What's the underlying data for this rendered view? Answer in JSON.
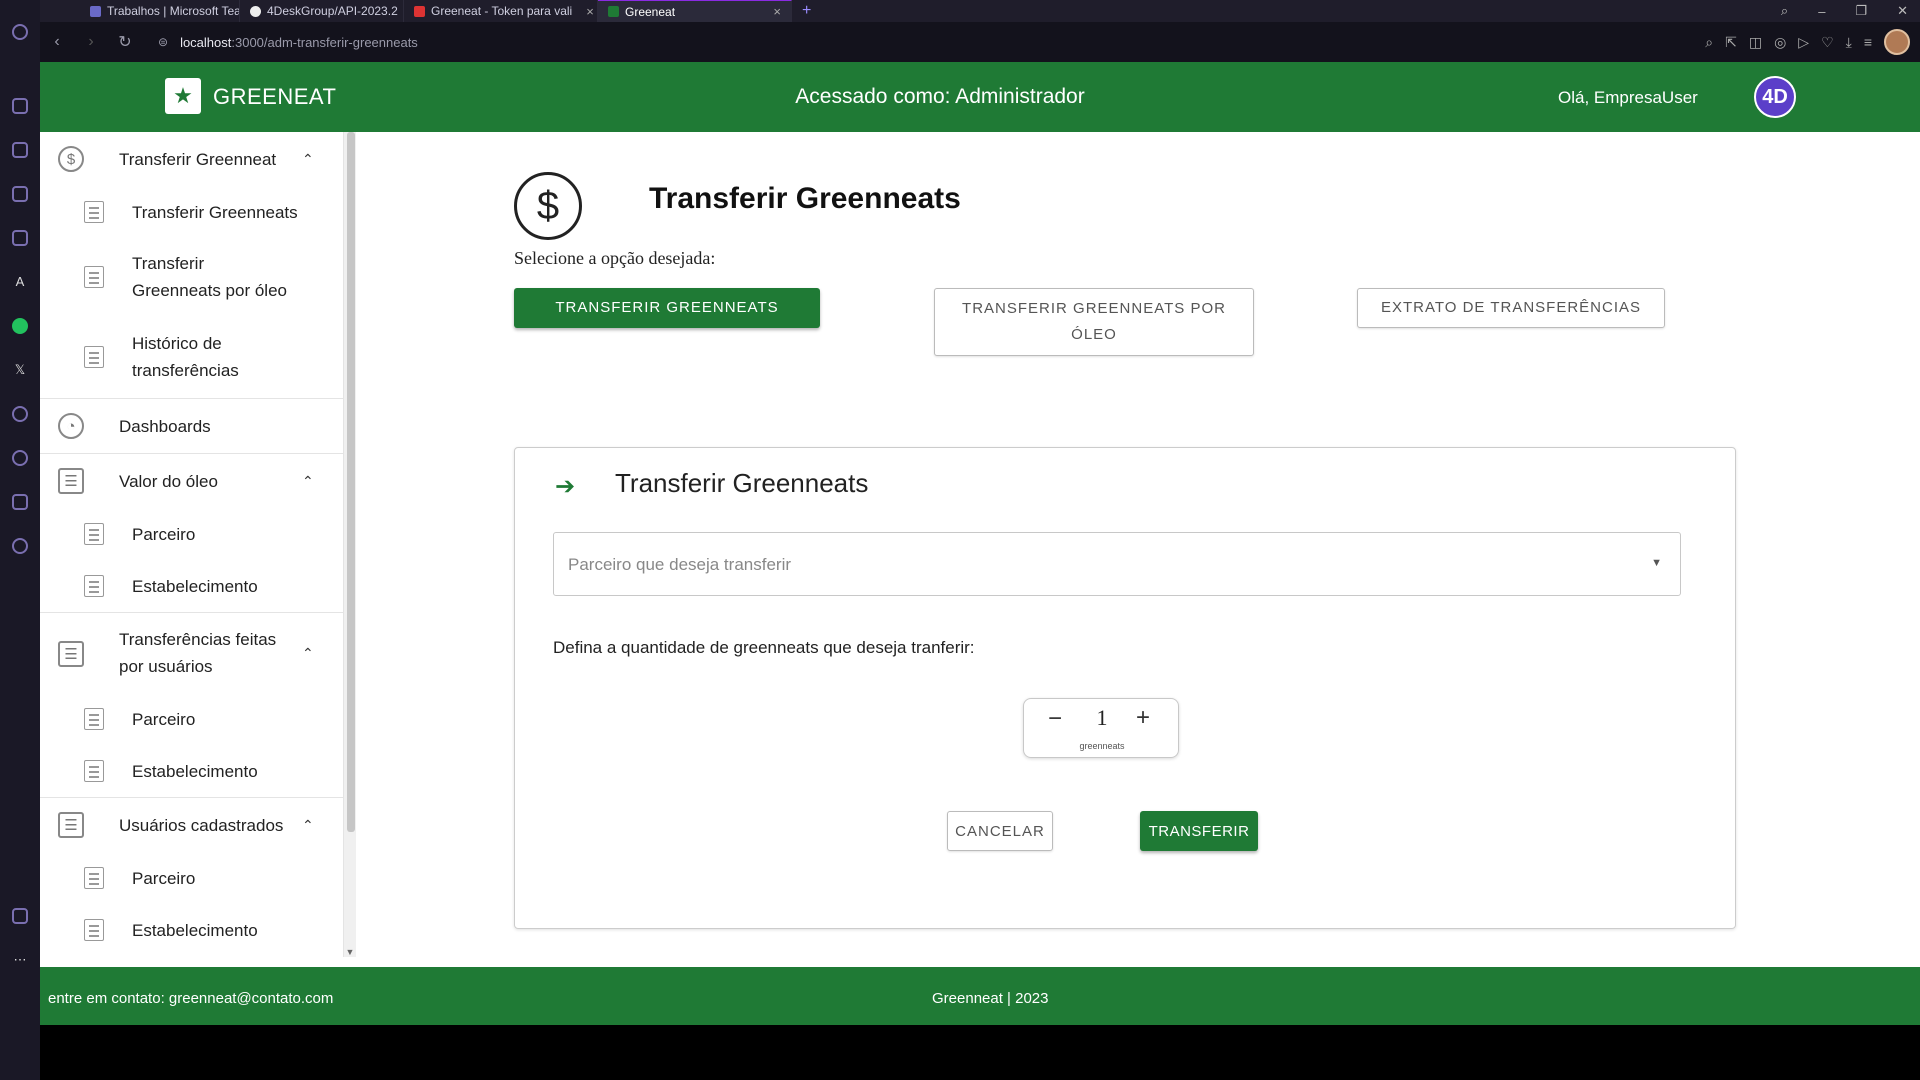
{
  "browser": {
    "tabs": [
      {
        "label": "Trabalhos | Microsoft Team",
        "active": false
      },
      {
        "label": "4DeskGroup/API-2023.2",
        "active": false
      },
      {
        "label": "Greeneat - Token para vali",
        "active": false
      },
      {
        "label": "Greeneat",
        "active": true
      }
    ],
    "url_host": "localhost",
    "url_path": ":3000/adm-transferir-greenneats"
  },
  "header": {
    "brand": "GREENEAT",
    "access": "Acessado como: Administrador",
    "hello": "Olá, EmpresaUser",
    "avatar": "4D"
  },
  "sidebar": {
    "groups": [
      {
        "label": "Transferir Greenneat",
        "icon": "dollar-circle-icon",
        "expanded": true,
        "items": [
          "Transferir Greenneats",
          "Transferir Greenneats por óleo",
          "Histórico de transferências"
        ]
      },
      {
        "label": "Dashboards",
        "icon": "chart-pie-icon",
        "expanded": false,
        "items": []
      },
      {
        "label": "Valor do óleo",
        "icon": "list-icon",
        "expanded": true,
        "items": [
          "Parceiro",
          "Estabelecimento"
        ]
      },
      {
        "label": "Transferências feitas por usuários",
        "icon": "list-icon",
        "expanded": true,
        "items": [
          "Parceiro",
          "Estabelecimento"
        ]
      },
      {
        "label": "Usuários cadastrados",
        "icon": "list-icon",
        "expanded": true,
        "items": [
          "Parceiro",
          "Estabelecimento"
        ]
      }
    ]
  },
  "main": {
    "title": "Transferir Greenneats",
    "subtitle": "Selecione a opção desejada:",
    "options": [
      {
        "label": "TRANSFERIR GREENNEATS",
        "selected": true
      },
      {
        "label": "TRANSFERIR GREENNEATS POR ÓLEO",
        "selected": false
      },
      {
        "label": "EXTRATO DE TRANSFERÊNCIAS",
        "selected": false
      }
    ],
    "card": {
      "title": "Transferir Greenneats",
      "select_placeholder": "Parceiro que deseja transferir",
      "qty_label": "Defina a quantidade de greenneats que deseja tranferir:",
      "quantity": "1",
      "unit": "greenneats",
      "cancel": "CANCELAR",
      "submit": "TRANSFERIR"
    }
  },
  "footer": {
    "contact": "entre em contato: greenneat@contato.com",
    "copyright": "Greenneat | 2023"
  },
  "colors": {
    "brand_green": "#1f7a35",
    "avatar_purple": "#5b3fc9"
  }
}
